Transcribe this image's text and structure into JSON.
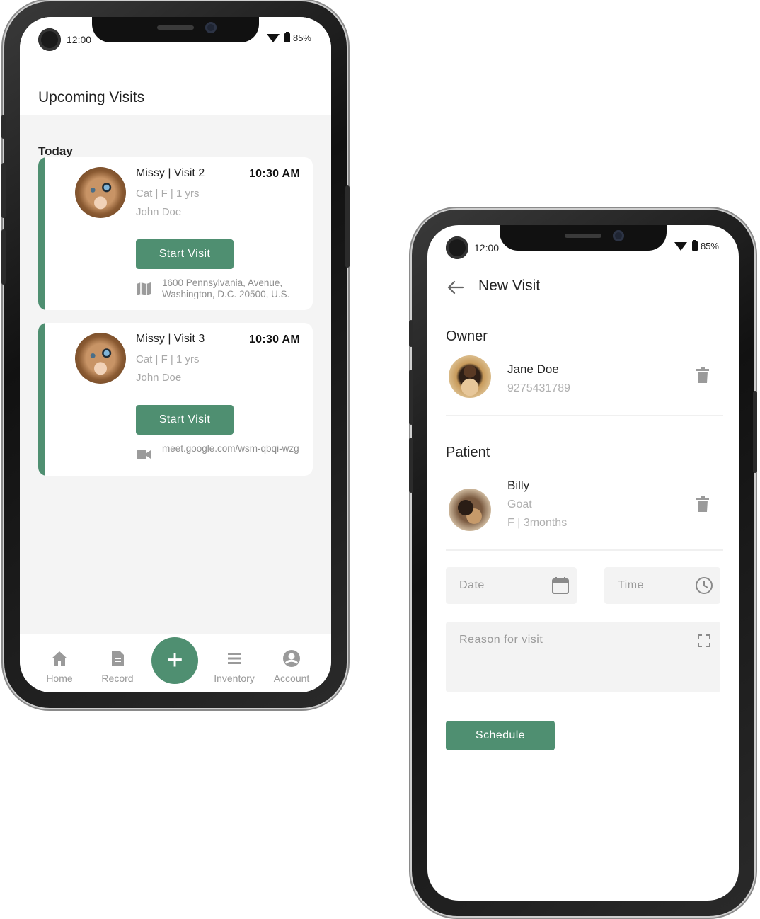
{
  "status_bar": {
    "time": "12:00",
    "battery": "85%"
  },
  "upcoming": {
    "title": "Upcoming Visits",
    "section": "Today",
    "visits": [
      {
        "name": "Missy | Visit 2",
        "time": "10:30 AM",
        "details": "Cat | F | 1 yrs",
        "owner": "John Doe",
        "button": "Start Visit",
        "location_icon": "map-icon",
        "location": "1600 Pennsylvania, Avenue, Washington, D.C. 20500, U.S."
      },
      {
        "name": "Missy | Visit 3",
        "time": "10:30 AM",
        "details": "Cat | F | 1 yrs",
        "owner": "John Doe",
        "button": "Start Visit",
        "location_icon": "video-icon",
        "location": "meet.google.com/wsm-qbqi-wzg"
      }
    ],
    "nav": [
      {
        "label": "Home",
        "icon": "home-icon"
      },
      {
        "label": "Record",
        "icon": "document-icon"
      },
      {
        "label": "+",
        "icon": "plus-icon"
      },
      {
        "label": "Inventory",
        "icon": "list-icon"
      },
      {
        "label": "Account",
        "icon": "account-icon"
      }
    ]
  },
  "new_visit": {
    "title": "New Visit",
    "owner_heading": "Owner",
    "owner": {
      "name": "Jane Doe",
      "phone": "9275431789"
    },
    "patient_heading": "Patient",
    "patient": {
      "name": "Billy",
      "species": "Goat",
      "details": "F | 3months"
    },
    "date_placeholder": "Date",
    "time_placeholder": "Time",
    "reason_placeholder": "Reason for visit",
    "schedule": "Schedule"
  },
  "colors": {
    "accent": "#4f8f71",
    "muted_text": "#a9a9a9",
    "background": "#f4f4f4"
  }
}
